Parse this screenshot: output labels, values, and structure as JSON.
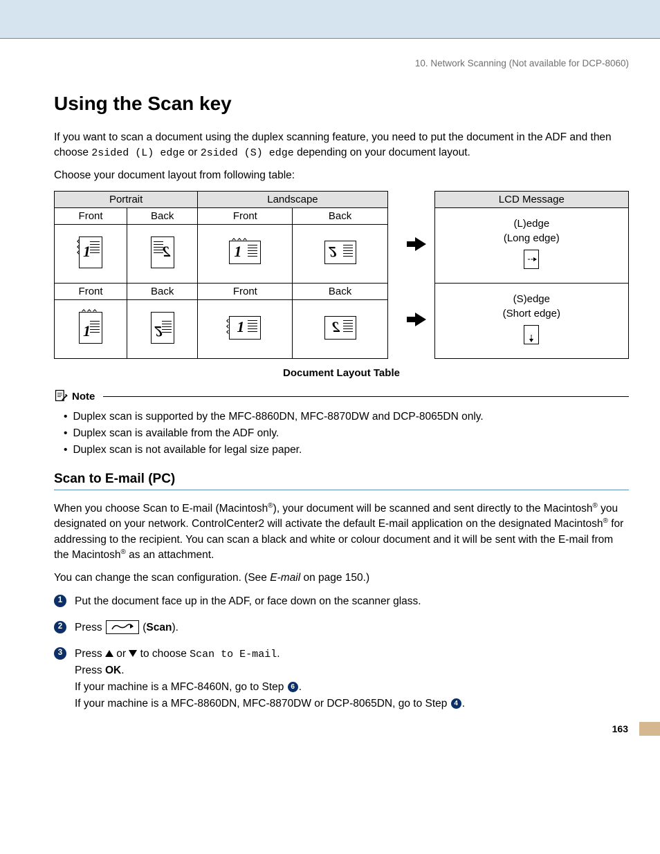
{
  "breadcrumb": "10. Network Scanning (Not available for DCP-8060)",
  "h1": "Using the Scan key",
  "intro": {
    "part1": "If you want to scan a document using the duplex scanning feature, you need to put the document in the ADF and then choose ",
    "code1": "2sided (L) edge",
    "mid": " or ",
    "code2": "2sided (S) edge",
    "part2": " depending on your document layout.",
    "line2": "Choose your document layout from following table:"
  },
  "table": {
    "head_portrait": "Portrait",
    "head_landscape": "Landscape",
    "head_lcd": "LCD Message",
    "front": "Front",
    "back": "Back",
    "lcd_long_1": "(L)edge",
    "lcd_long_2": "(Long edge)",
    "lcd_short_1": "(S)edge",
    "lcd_short_2": "(Short edge)"
  },
  "caption": "Document Layout Table",
  "note_label": "Note",
  "notes": [
    "Duplex scan is supported by the MFC-8860DN, MFC-8870DW and DCP-8065DN only.",
    "Duplex scan is available from the ADF only.",
    "Duplex scan is not available for legal size paper."
  ],
  "h2": "Scan to E-mail (PC)",
  "p2": {
    "a": "When you choose Scan to E-mail (Macintosh",
    "b": "), your document will be scanned and sent directly to the Macintosh",
    "c": " you designated on your network. ControlCenter2 will activate the default E-mail application on the designated Macintosh",
    "d": " for addressing to the recipient. You can scan a black and white or colour document and it will be sent with the E-mail from the Macintosh",
    "e": " as an attachment."
  },
  "p3_a": "You can change the scan configuration. (See ",
  "p3_i": "E-mail",
  "p3_b": " on page 150.)",
  "steps": {
    "s1": "Put the document face up in the ADF, or face down on the scanner glass.",
    "s2_a": "Press ",
    "s2_b": " (",
    "s2_c": "Scan",
    "s2_d": ").",
    "s3_a": "Press ",
    "s3_b": " or ",
    "s3_c": " to choose ",
    "s3_code": "Scan to E-mail",
    "s3_d": ".",
    "s3_e": "Press ",
    "s3_ok": "OK",
    "s3_f": "If your machine is a MFC-8460N, go to Step ",
    "s3_g": "If your machine is a MFC-8860DN, MFC-8870DW or DCP-8065DN, go to Step "
  },
  "page_number": "163"
}
